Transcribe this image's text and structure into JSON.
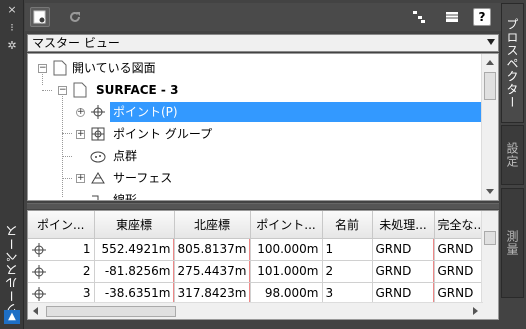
{
  "palette": {
    "window_bg": "#434343",
    "selection": "#3399ff",
    "text_light": "#ffffff"
  },
  "side": {
    "title": "ツールスペース",
    "close_glyph": "×",
    "pin_glyph": "⁝",
    "settings_glyph": "✲",
    "logo_glyph": "▲"
  },
  "toolbar": {
    "icons": [
      "prospector-view-icon",
      "refresh-icon",
      "item-list-icon",
      "table-view-icon",
      "help-icon"
    ],
    "help_label": "?"
  },
  "view_select": {
    "value": "マスター ビュー"
  },
  "tree": {
    "items": [
      {
        "label": "開いている図面",
        "icon": "document-icon",
        "expander": "−"
      },
      {
        "label": "SURFACE - 3",
        "icon": "document-icon",
        "expander": "−",
        "bold": true
      },
      {
        "label": "ポイント(P)",
        "icon": "point-icon",
        "expander": "+",
        "selected": true
      },
      {
        "label": "ポイント グループ",
        "icon": "point-group-icon",
        "expander": "+"
      },
      {
        "label": "点群",
        "icon": "point-cloud-icon",
        "expander": ""
      },
      {
        "label": "サーフェス",
        "icon": "surface-icon",
        "expander": "+"
      },
      {
        "label": "線形",
        "icon": "alignment-icon",
        "expander": ""
      }
    ]
  },
  "grid": {
    "columns": [
      "ポイン...",
      "東座標",
      "北座標",
      "ポイント...",
      "名前",
      "未処理...",
      "完全な..."
    ],
    "rows": [
      {
        "num": "1",
        "east": "552.4921m",
        "north": "805.8137m",
        "elev": "100.000m",
        "name": "1",
        "raw": "GRND",
        "full": "GRND"
      },
      {
        "num": "2",
        "east": "-81.8256m",
        "north": "275.4437m",
        "elev": "101.000m",
        "name": "2",
        "raw": "GRND",
        "full": "GRND"
      },
      {
        "num": "3",
        "east": "-38.6351m",
        "north": "317.8423m",
        "elev": "98.000m",
        "name": "3",
        "raw": "GRND",
        "full": "GRND"
      }
    ]
  },
  "tabs": [
    {
      "label": "プロスペクター",
      "active": true
    },
    {
      "label": "設定",
      "active": false
    },
    {
      "label": "測量",
      "active": false
    }
  ]
}
